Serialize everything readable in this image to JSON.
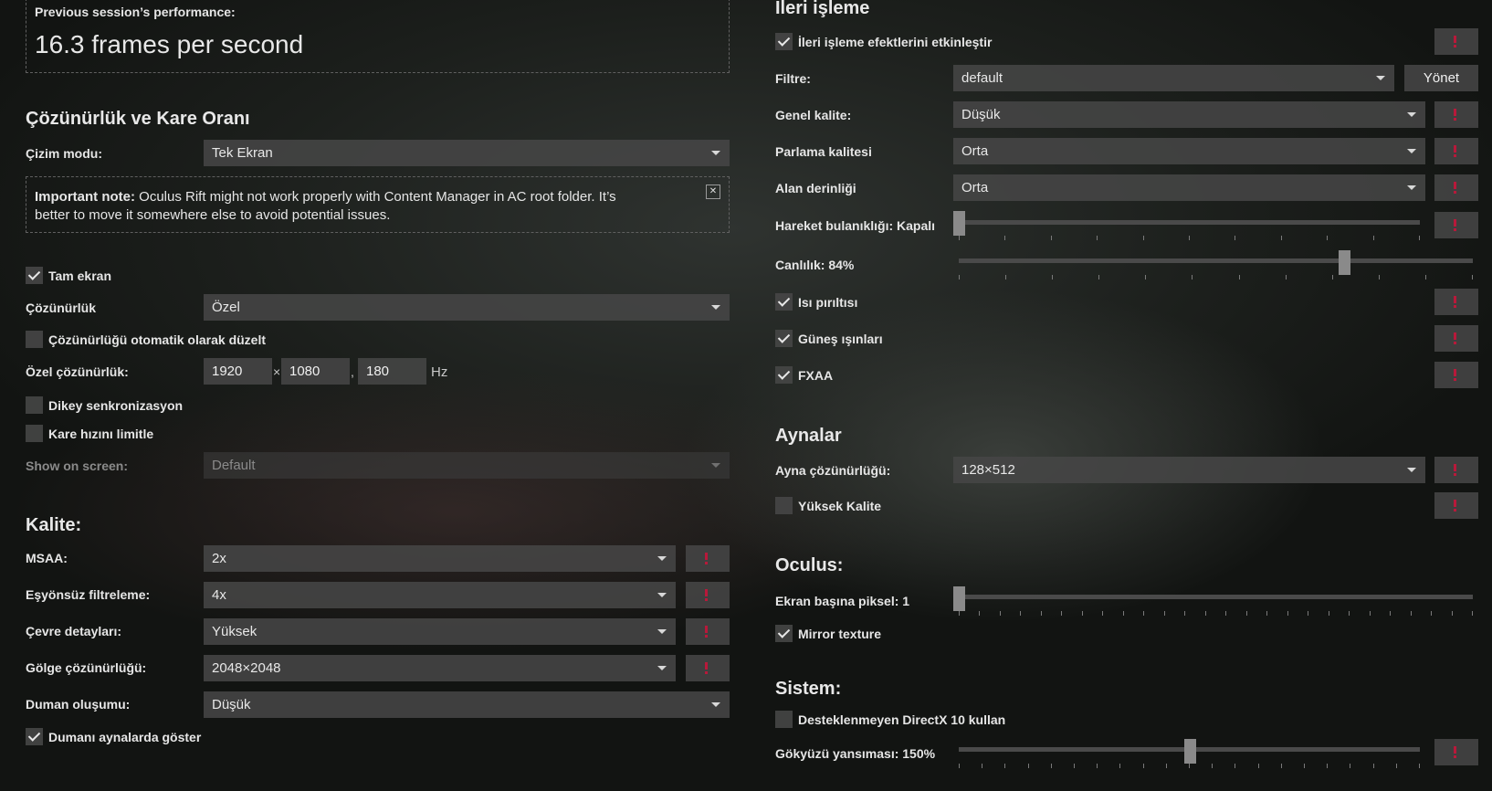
{
  "performance": {
    "label": "Previous session’s performance:",
    "value": "16.3 frames per second"
  },
  "resolution_section": {
    "title": "Çözünürlük ve Kare Oranı",
    "render_mode_label": "Çizim modu:",
    "render_mode_value": "Tek Ekran",
    "note_bold": "Important note:",
    "note_line1": " Oculus Rift might not work properly with Content Manager in AC root folder. It’s",
    "note_line2": "better to move it somewhere else to avoid potential issues.",
    "close_glyph": "✕",
    "fullscreen_label": "Tam ekran",
    "resolution_label": "Çözünürlük",
    "resolution_value": "Özel",
    "auto_fix_label": "Çözünürlüğü otomatik olarak düzelt",
    "custom_res_label": "Özel çözünürlük:",
    "width": "1920",
    "times": "×",
    "height": "1080",
    "comma": ",",
    "refresh": "180",
    "hz": "Hz",
    "vsync_label": "Dikey senkronizasyon",
    "limit_fps_label": "Kare hızını limitle",
    "show_on_screen_label": "Show on screen:",
    "show_on_screen_value": "Default"
  },
  "quality_section": {
    "title": "Kalite:",
    "msaa_label": "MSAA:",
    "msaa_value": "2x",
    "aniso_label": "Eşyönsüz filtreleme:",
    "aniso_value": "4x",
    "world_label": "Çevre detayları:",
    "world_value": "Yüksek",
    "shadow_label": "Gölge çözünürlüğü:",
    "shadow_value": "2048×2048",
    "smoke_label": "Duman oluşumu:",
    "smoke_value": "Düşük",
    "smoke_mirror_label": "Dumanı aynalarda göster"
  },
  "post_section": {
    "title": "İleri işleme",
    "enable_label": "İleri işleme efektlerini etkinleştir",
    "filter_label": "Filtre:",
    "filter_value": "default",
    "manage_button": "Yönet",
    "overall_label": "Genel kalite:",
    "overall_value": "Düşük",
    "glare_label": "Parlama kalitesi",
    "glare_value": "Orta",
    "dof_label": "Alan derinliği",
    "dof_value": "Orta",
    "motion_blur_label": "Hareket bulanıklığı: Kapalı",
    "motion_blur_level": 0,
    "saturation_label": "Canlılık: 84%",
    "saturation_level": 0.75,
    "heat_label": "Isı pırıltısı",
    "sunrays_label": "Güneş ışınları",
    "fxaa_label": "FXAA"
  },
  "mirrors_section": {
    "title": "Aynalar",
    "res_label": "Ayna çözünürlüğü:",
    "res_value": "128×512",
    "hq_label": "Yüksek Kalite"
  },
  "oculus_section": {
    "title": "Oculus:",
    "pixels_label": "Ekran başına piksel: 1",
    "pixels_level": 0,
    "mirror_texture_label": "Mirror texture"
  },
  "system_section": {
    "title": "Sistem:",
    "dx10_label": "Desteklenmeyen DirectX 10 kullan",
    "sky_label": "Gökyüzü yansıması: 150%",
    "sky_level": 0.5
  }
}
